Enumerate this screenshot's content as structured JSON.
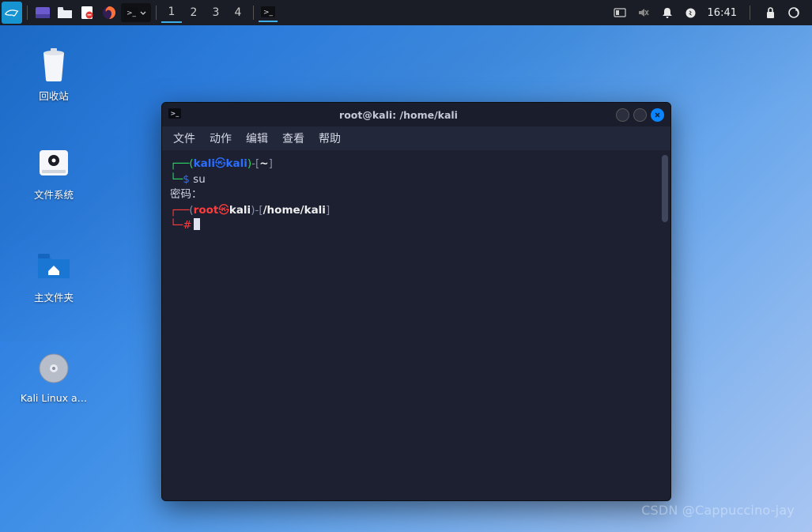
{
  "taskbar": {
    "workspaces": [
      "1",
      "2",
      "3",
      "4"
    ],
    "active_workspace": 0,
    "time": "16:41"
  },
  "desktop_icons": {
    "trash": "回收站",
    "filesystem": "文件系统",
    "home": "主文件夹",
    "kali": "Kali Linux a…"
  },
  "terminal": {
    "title": "root@kali: /home/kali",
    "menu": {
      "file": "文件",
      "actions": "动作",
      "edit": "编辑",
      "view": "查看",
      "help": "帮助"
    },
    "content": {
      "line1_user": "kali",
      "line1_at_host": "kali",
      "line1_path": "~",
      "line2_prompt": "$",
      "line2_cmd": "su",
      "line3_password": "密码：",
      "line4_user": "root",
      "line4_at_host": "kali",
      "line4_path": "/home/kali",
      "line5_prompt": "#"
    }
  },
  "watermark": "CSDN @Cappuccino-jay"
}
